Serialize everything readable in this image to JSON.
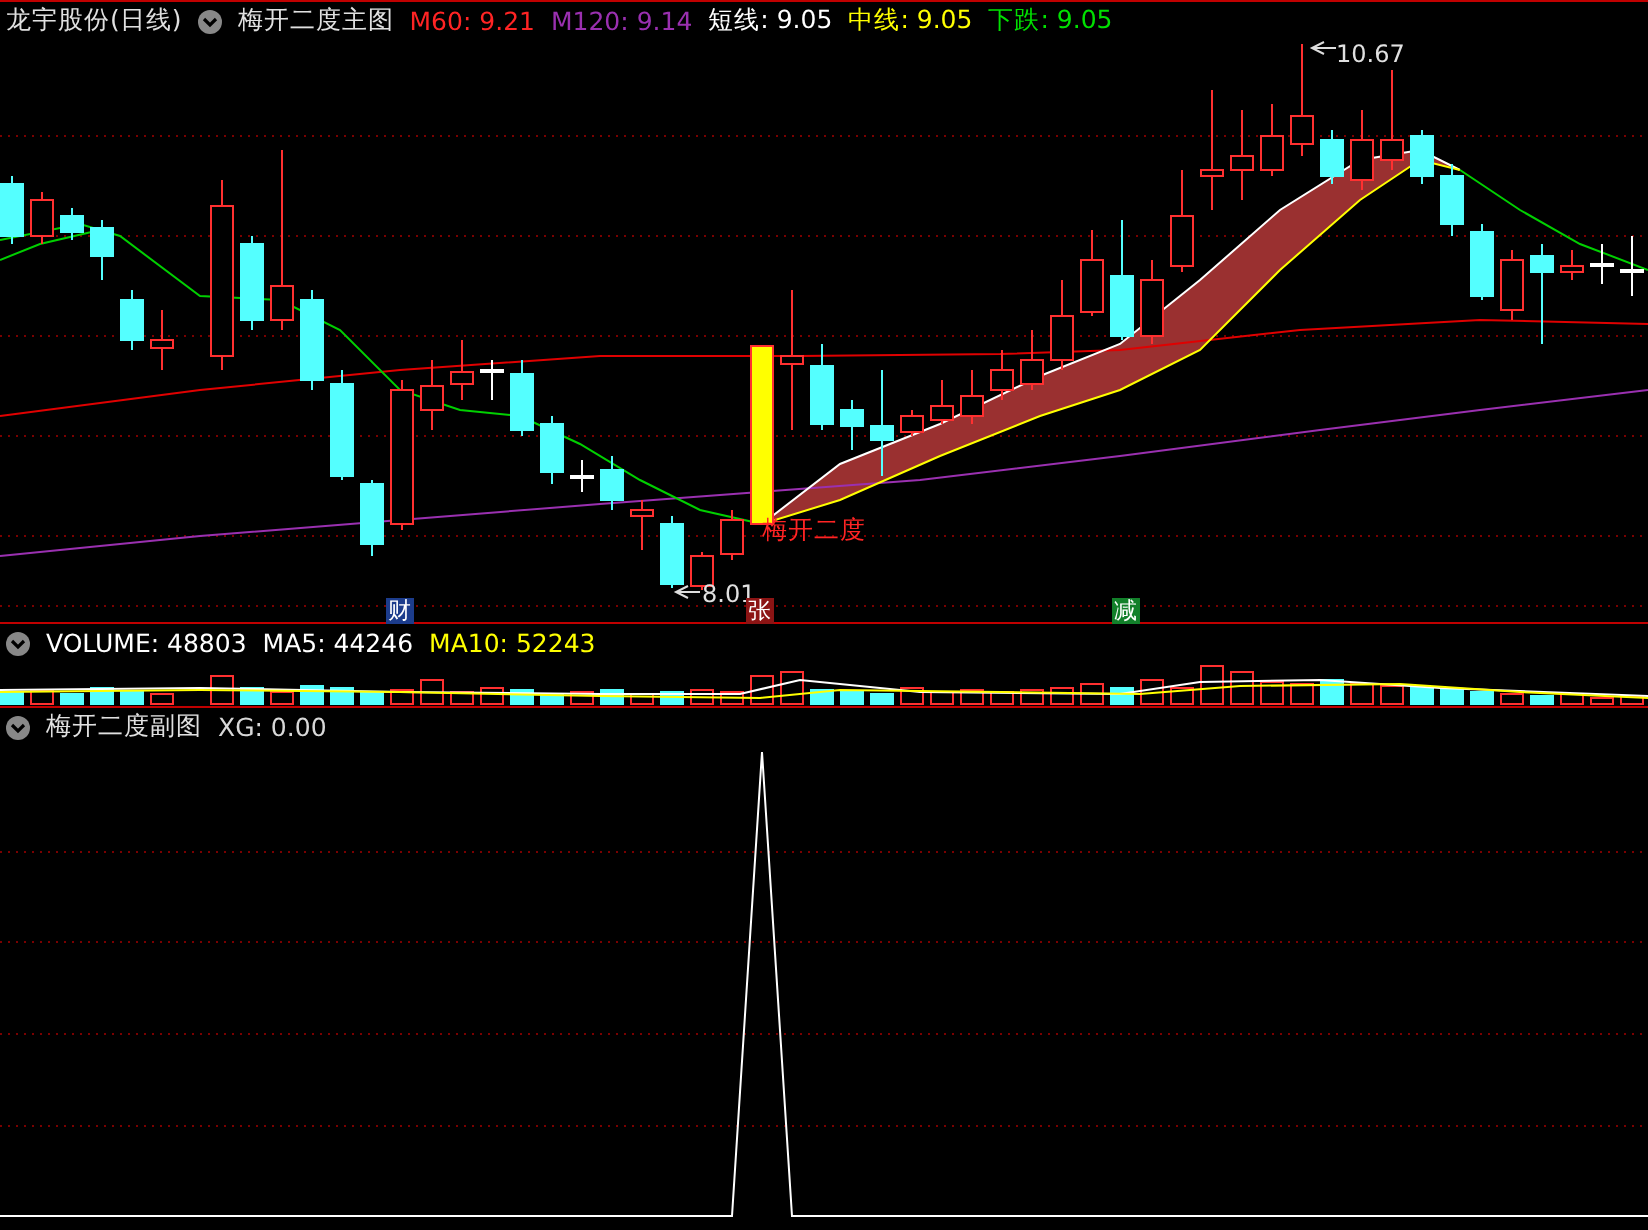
{
  "title": "龙宇股份(日线)",
  "main_panel": {
    "indicator": "梅开二度主图",
    "values": [
      {
        "text": "M60: 9.21",
        "color": "#ff2424"
      },
      {
        "text": "M120: 9.14",
        "color": "#9a30b0"
      },
      {
        "text": "短线: 9.05",
        "color": "#ffffff"
      },
      {
        "text": "中线: 9.05",
        "color": "#ffff00"
      },
      {
        "text": "下跌: 9.05",
        "color": "#00e000"
      }
    ],
    "high_label": "10.67",
    "low_label": "8.01",
    "signal_label": "梅开二度",
    "markers": [
      {
        "text": "财",
        "color": "#1c3c8c"
      },
      {
        "text": "张",
        "color": "#8c1414"
      },
      {
        "text": "减",
        "color": "#12802a"
      }
    ]
  },
  "volume_panel": {
    "values": [
      {
        "text": "VOLUME: 48803",
        "color": "#ffffff"
      },
      {
        "text": "MA5: 44246",
        "color": "#ffffff"
      },
      {
        "text": "MA10: 52243",
        "color": "#ffff00"
      }
    ]
  },
  "sub_panel": {
    "indicator": "梅开二度副图",
    "values": [
      {
        "text": "XG: 0.00",
        "color": "#d8d8d8"
      }
    ]
  }
}
